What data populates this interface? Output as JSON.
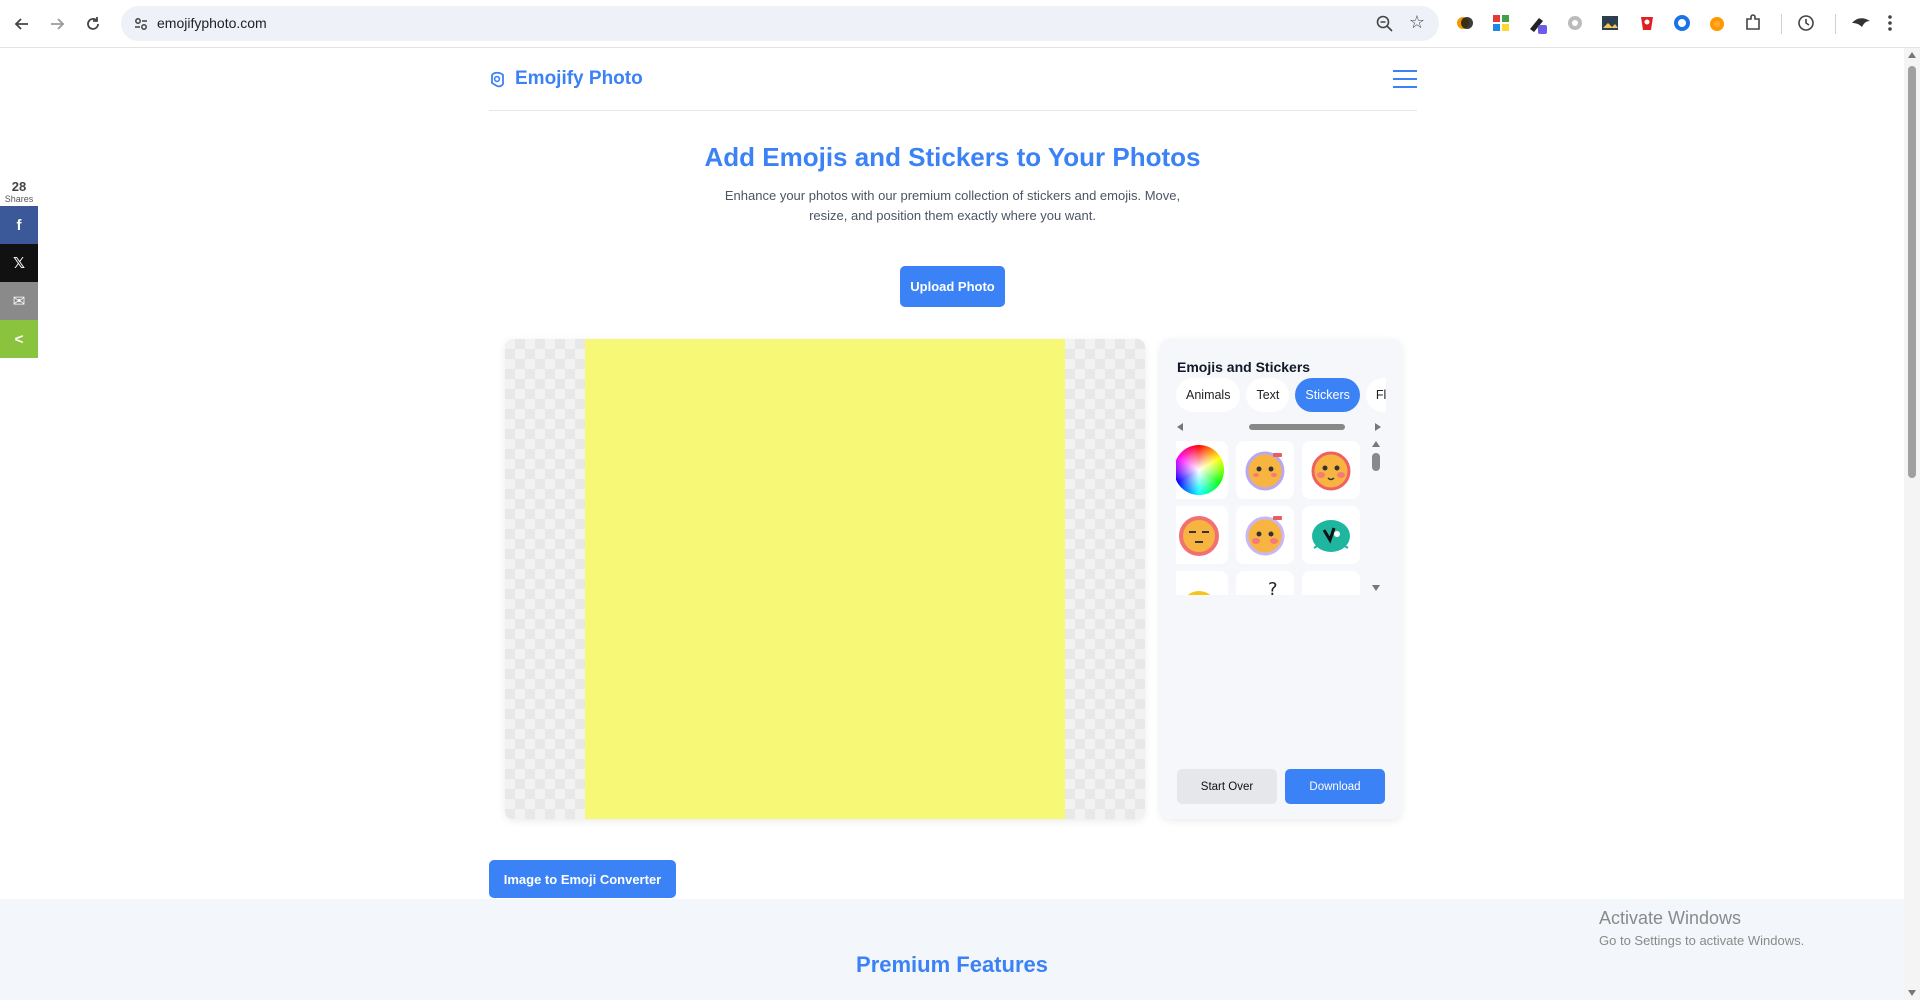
{
  "browser": {
    "url": "emojifyphoto.com"
  },
  "share": {
    "count": "28",
    "label": "Shares",
    "buttons": [
      {
        "icon": "facebook-icon",
        "glyph": "f",
        "color": "#3b5998"
      },
      {
        "icon": "x-icon",
        "glyph": "𝕏",
        "color": "#111111"
      },
      {
        "icon": "email-icon",
        "glyph": "✉",
        "color": "#8a8a8a"
      },
      {
        "icon": "share-icon",
        "glyph": "<",
        "color": "#8ac43f"
      }
    ]
  },
  "header": {
    "brand": "Emojify Photo"
  },
  "hero": {
    "title": "Add Emojis and Stickers to Your Photos",
    "subtitle": "Enhance your photos with our premium collection of stickers and emojis. Move, resize, and position them exactly where you want.",
    "upload_label": "Upload Photo"
  },
  "editor": {
    "canvas_color": "#f7f876",
    "panel_title": "Emojis and Stickers",
    "tabs": [
      {
        "label": "Animals",
        "active": false
      },
      {
        "label": "Text",
        "active": false
      },
      {
        "label": "Stickers",
        "active": true
      },
      {
        "label": "Flags",
        "active": false
      }
    ],
    "stickers": [
      {
        "name": "color-wheel-sticker"
      },
      {
        "name": "blushing-face-sticker"
      },
      {
        "name": "red-cheeks-face-sticker"
      },
      {
        "name": "sleepy-face-sticker"
      },
      {
        "name": "shy-face-sticker"
      },
      {
        "name": "teal-face-sticker"
      },
      {
        "name": "big-eyes-sticker"
      },
      {
        "name": "thinking-question-sticker"
      },
      {
        "name": "fire-face-sticker"
      }
    ],
    "start_over_label": "Start Over",
    "download_label": "Download"
  },
  "converter_label": "Image to Emoji Converter",
  "features_title": "Premium Features",
  "watermark": {
    "line1": "Activate Windows",
    "line2": "Go to Settings to activate Windows."
  },
  "colors": {
    "accent": "#3b82f6"
  }
}
